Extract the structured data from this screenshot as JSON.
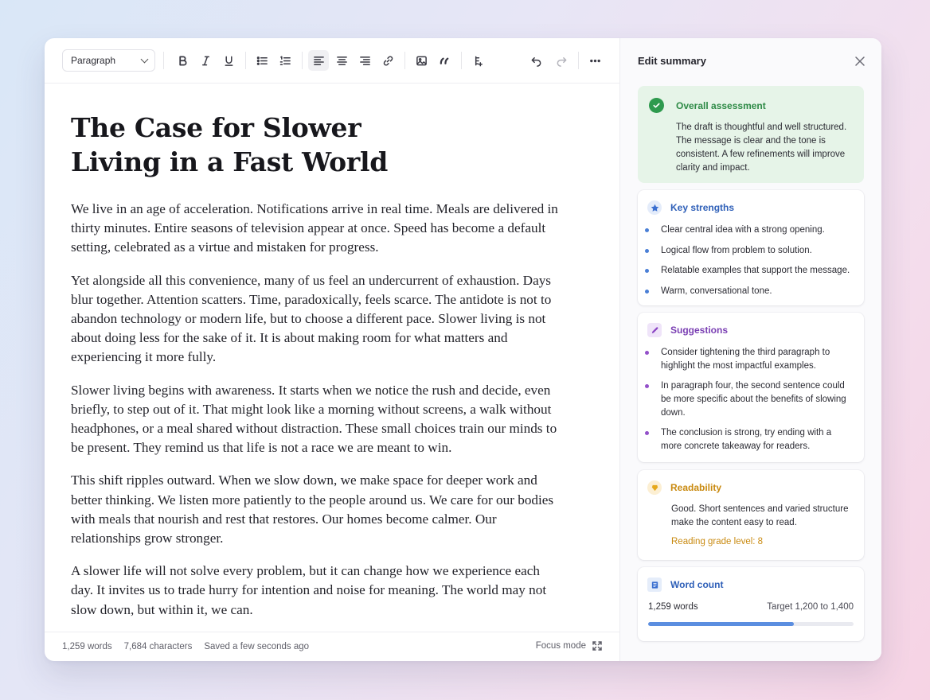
{
  "toolbar": {
    "style_select": "Paragraph",
    "icons": [
      "bold-icon",
      "italic-icon",
      "underline-icon",
      "bullet-list-icon",
      "numbered-list-icon",
      "align-left-icon",
      "align-center-icon",
      "align-right-icon",
      "link-icon",
      "image-icon",
      "quote-icon",
      "insert-icon",
      "undo-icon",
      "redo-icon",
      "more-icon"
    ]
  },
  "document": {
    "title": "The Case for Slower Living in a Fast World",
    "paragraphs": [
      "We live in an age of acceleration. Notifications arrive in real time. Meals are delivered in thirty minutes. Entire seasons of television appear at once. Speed has become a default setting, celebrated as a virtue and mistaken for progress.",
      "Yet alongside all this convenience, many of us feel an undercurrent of exhaustion. Days blur together. Attention scatters. Time, paradoxically, feels scarce. The antidote is not to abandon technology or modern life, but to choose a different pace. Slower living is not about doing less for the sake of it. It is about making room for what matters and experiencing it more fully.",
      "Slower living begins with awareness. It starts when we notice the rush and decide, even briefly, to step out of it. That might look like a morning without screens, a walk without headphones, or a meal shared without distraction. These small choices train our minds to be present. They remind us that life is not a race we are meant to win.",
      "This shift ripples outward. When we slow down, we make space for deeper work and better thinking. We listen more patiently to the people around us. We care for our bodies with meals that nourish and rest that restores. Our homes become calmer. Our relationships grow stronger.",
      "A slower life will not solve every problem, but it can change how we experience each day. It invites us to trade hurry for intention and noise for meaning. The world may not slow down, but within it, we can."
    ]
  },
  "status": {
    "words": "1,259 words",
    "characters": "7,684 characters",
    "saved": "Saved a few seconds ago",
    "focus_mode": "Focus mode"
  },
  "summary": {
    "title": "Edit summary",
    "overall": {
      "heading": "Overall assessment",
      "text": "The draft is thoughtful and well structured. The message is clear and the tone is consistent. A few refinements will improve clarity and impact."
    },
    "strengths": {
      "heading": "Key strengths",
      "items": [
        "Clear central idea with a strong opening.",
        "Logical flow from problem to solution.",
        "Relatable examples that support the message.",
        "Warm, conversational tone."
      ]
    },
    "suggestions": {
      "heading": "Suggestions",
      "items": [
        "Consider tightening the third paragraph to highlight the most impactful examples.",
        "In paragraph four, the second sentence could be more specific about the benefits of slowing down.",
        "The conclusion is strong, try ending with a more concrete takeaway for readers."
      ]
    },
    "readability": {
      "heading": "Readability",
      "text": "Good. Short sentences and varied structure make the content easy to read.",
      "grade": "Reading grade level: 8"
    },
    "word_count": {
      "heading": "Word count",
      "count": "1,259 words",
      "target": "Target 1,200 to 1,400",
      "progress": 0.71
    }
  },
  "colors": {
    "overall": "#2e8a46",
    "strengths": "#2e5fb8",
    "suggestions": "#7a3fb3",
    "readability": "#c98a10",
    "progress": "#5b8ee0"
  }
}
